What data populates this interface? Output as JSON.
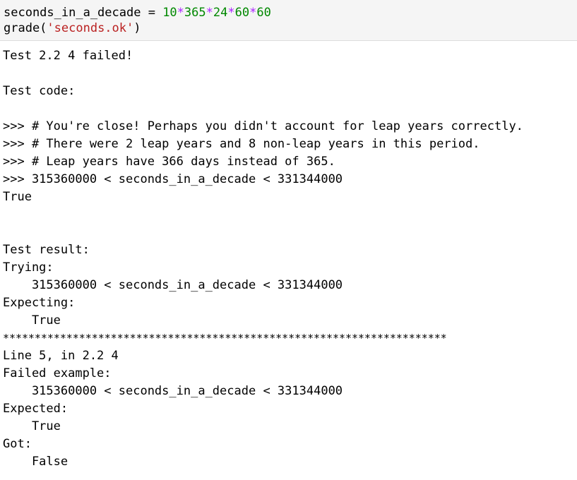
{
  "input": {
    "line1": {
      "var": "seconds_in_a_decade",
      "assign": " = ",
      "n1": "10",
      "op1": "*",
      "n2": "365",
      "op2": "*",
      "n3": "24",
      "op3": "*",
      "n4": "60",
      "op4": "*",
      "n5": "60"
    },
    "line2": {
      "func": "grade(",
      "arg": "'seconds.ok'",
      "close": ")"
    }
  },
  "output": {
    "lines": [
      "Test 2.2 4 failed!",
      "",
      "Test code:",
      "",
      ">>> # You're close! Perhaps you didn't account for leap years correctly.",
      ">>> # There were 2 leap years and 8 non-leap years in this period.",
      ">>> # Leap years have 366 days instead of 365.",
      ">>> 315360000 < seconds_in_a_decade < 331344000",
      "True",
      "",
      "",
      "Test result:",
      "Trying:",
      "    315360000 < seconds_in_a_decade < 331344000",
      "Expecting:",
      "    True",
      "**********************************************************************",
      "Line 5, in 2.2 4",
      "Failed example:",
      "    315360000 < seconds_in_a_decade < 331344000",
      "Expected:",
      "    True",
      "Got:",
      "    False"
    ]
  }
}
